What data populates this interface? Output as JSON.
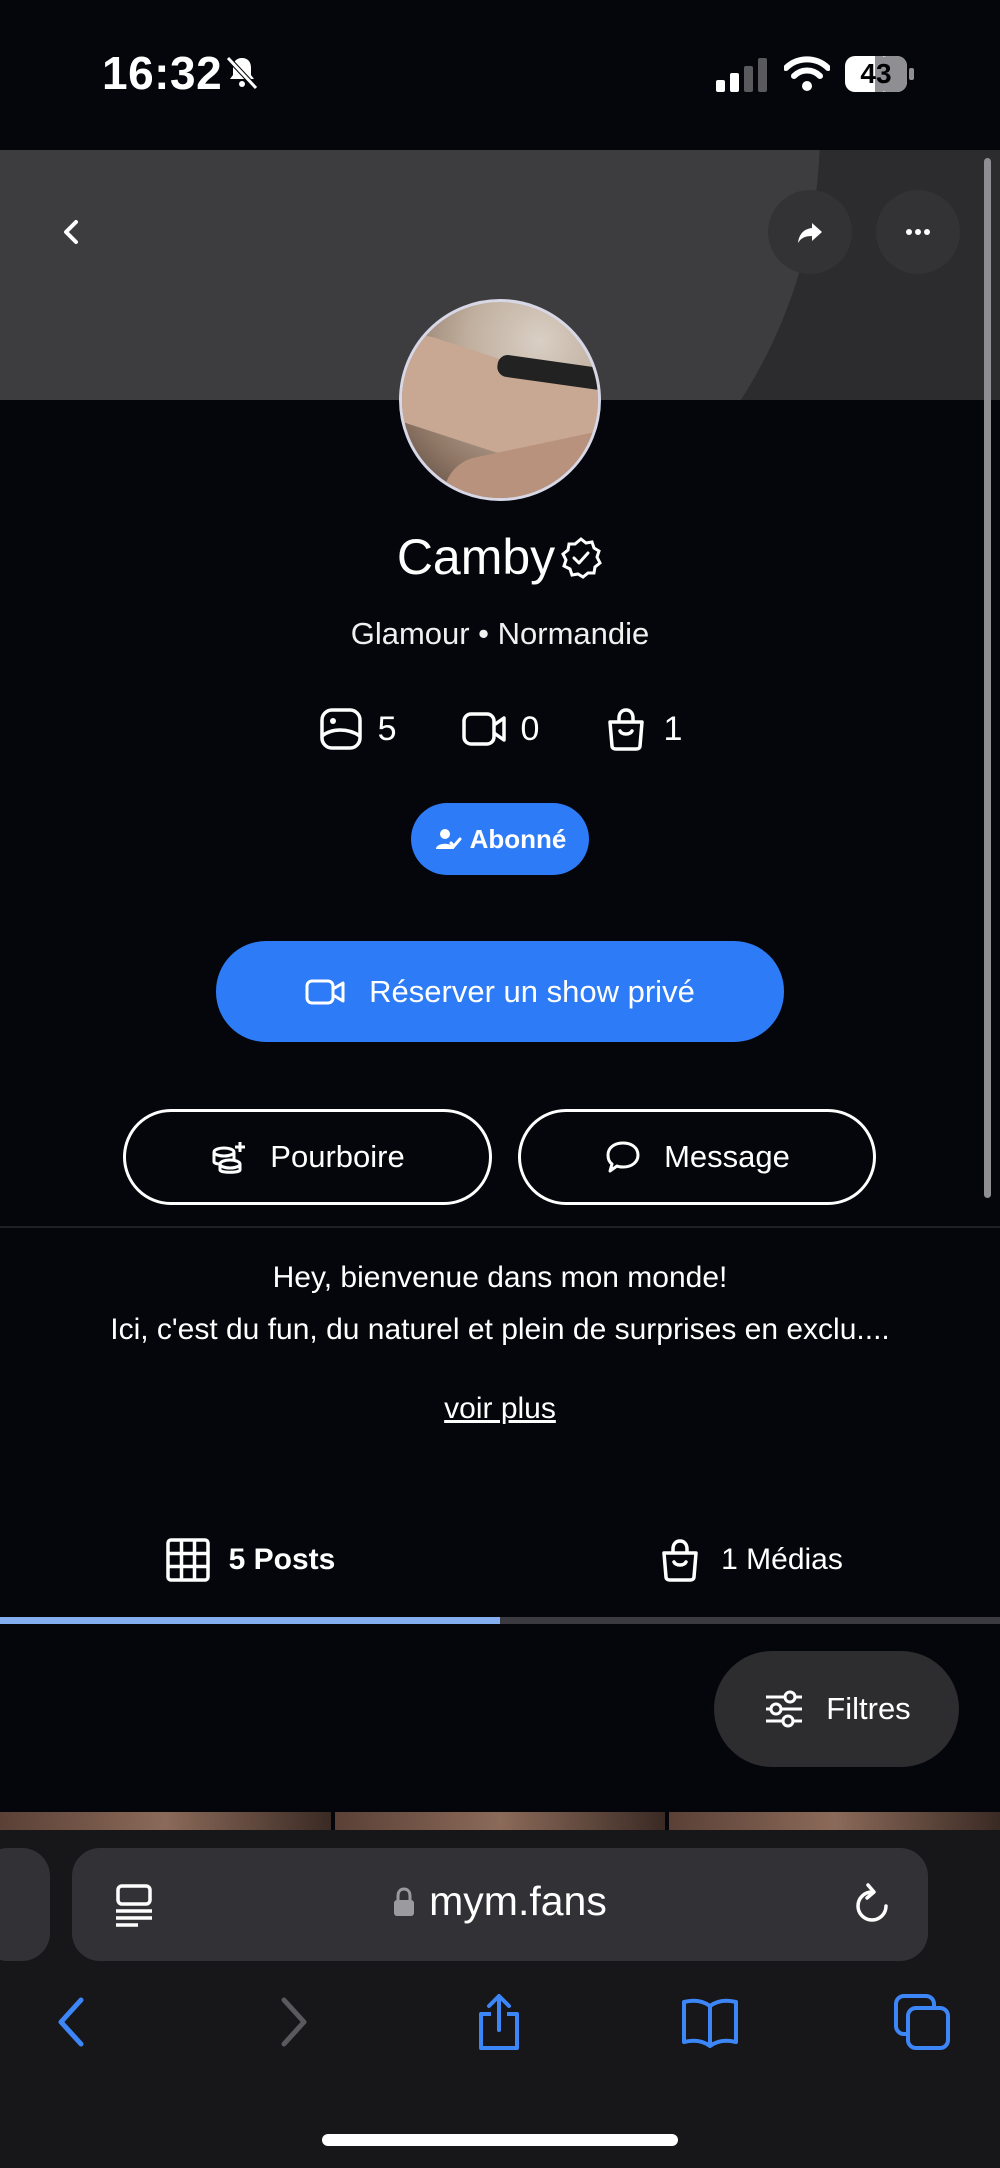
{
  "status_bar": {
    "time": "16:32",
    "battery": "43"
  },
  "profile": {
    "name": "Camby",
    "subtitle": "Glamour • Normandie",
    "stats": {
      "photos": "5",
      "videos": "0",
      "medias": "1"
    },
    "subscribed_label": "Abonné"
  },
  "actions": {
    "private_show": "Réserver un show privé",
    "tip": "Pourboire",
    "message": "Message"
  },
  "bio": {
    "line1": "Hey, bienvenue dans mon monde!",
    "line2": "Ici, c'est du fun, du naturel et plein de surprises en exclu....",
    "more": "voir plus"
  },
  "tabs": {
    "posts": "5 Posts",
    "medias": "1 Médias",
    "active_fraction": 0.5
  },
  "filters_label": "Filtres",
  "browser": {
    "url": "mym.fans"
  },
  "colors": {
    "accent": "#2d7bf6",
    "background": "#05060b",
    "tab_active": "#85aef0",
    "safari_blue": "#3d86f7"
  },
  "icons": [
    "back-arrow-icon",
    "share-icon",
    "more-icon",
    "verified-icon",
    "photo-icon",
    "video-icon",
    "bag-icon",
    "user-check-icon",
    "camera-icon",
    "coins-icon",
    "chat-icon",
    "grid-icon",
    "sliders-icon",
    "reader-icon",
    "lock-icon",
    "reload-icon",
    "tabs-icon",
    "bookmarks-icon"
  ]
}
